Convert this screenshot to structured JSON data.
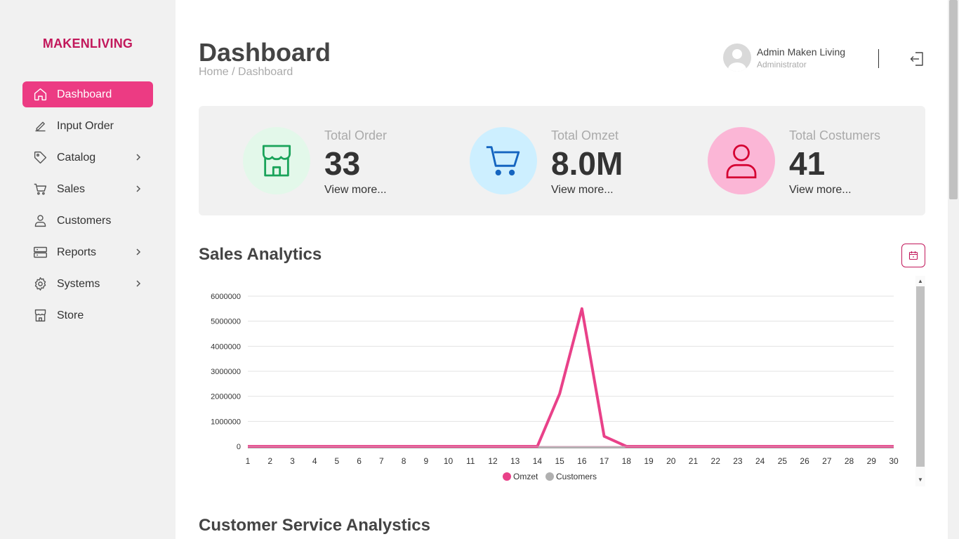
{
  "brand": "MAKENLIVING",
  "sidebar": {
    "items": [
      {
        "label": "Dashboard",
        "icon": "home-icon",
        "active": true
      },
      {
        "label": "Input Order",
        "icon": "pencil-icon"
      },
      {
        "label": "Catalog",
        "icon": "tag-icon",
        "has_sub": true
      },
      {
        "label": "Sales",
        "icon": "cart-icon",
        "has_sub": true
      },
      {
        "label": "Customers",
        "icon": "person-icon"
      },
      {
        "label": "Reports",
        "icon": "server-icon",
        "has_sub": true
      },
      {
        "label": "Systems",
        "icon": "gear-icon",
        "has_sub": true
      },
      {
        "label": "Store",
        "icon": "store-icon"
      }
    ]
  },
  "header": {
    "title": "Dashboard",
    "breadcrumb": "Home / Dashboard",
    "user_name": "Admin Maken Living",
    "user_role": "Administrator"
  },
  "stats": [
    {
      "label": "Total Order",
      "value": "33",
      "link": "View more...",
      "icon": "store-icon",
      "circle_color": "#e3f8ea",
      "icon_color": "#1aa35a"
    },
    {
      "label": "Total Omzet",
      "value": "8.0M",
      "link": "View more...",
      "icon": "cart-icon",
      "circle_color": "#cdefff",
      "icon_color": "#1565c0"
    },
    {
      "label": "Total Costumers",
      "value": "41",
      "link": "View more...",
      "icon": "person-icon",
      "circle_color": "#fbb6d6",
      "icon_color": "#d50032"
    }
  ],
  "sections": {
    "sales_title": "Sales Analytics",
    "cs_title": "Customer Service Analystics"
  },
  "colors": {
    "accent": "#ec3b83",
    "brand": "#c2185b"
  },
  "chart_data": {
    "type": "line",
    "categories": [
      "1",
      "2",
      "3",
      "4",
      "5",
      "6",
      "7",
      "8",
      "9",
      "10",
      "11",
      "12",
      "13",
      "14",
      "15",
      "16",
      "17",
      "18",
      "19",
      "20",
      "21",
      "22",
      "23",
      "24",
      "25",
      "26",
      "27",
      "28",
      "29",
      "30"
    ],
    "yticks": [
      "0",
      "1000000",
      "2000000",
      "3000000",
      "4000000",
      "5000000",
      "6000000"
    ],
    "ylim": [
      0,
      6000000
    ],
    "series": [
      {
        "name": "Omzet",
        "color": "#e94189",
        "values": [
          0,
          0,
          0,
          0,
          0,
          0,
          0,
          0,
          0,
          0,
          0,
          0,
          0,
          0,
          2100000,
          5500000,
          400000,
          0,
          0,
          0,
          0,
          0,
          0,
          0,
          0,
          0,
          0,
          0,
          0,
          0
        ]
      },
      {
        "name": "Customers",
        "color": "#b0b0b0",
        "values": [
          2,
          1,
          1,
          1,
          1,
          1,
          1,
          1,
          1,
          1,
          1,
          1,
          1,
          3,
          8,
          12,
          4,
          1,
          1,
          1,
          1,
          1,
          1,
          1,
          1,
          1,
          1,
          1,
          1,
          1
        ]
      }
    ],
    "legend": "bottom",
    "grid": true
  }
}
